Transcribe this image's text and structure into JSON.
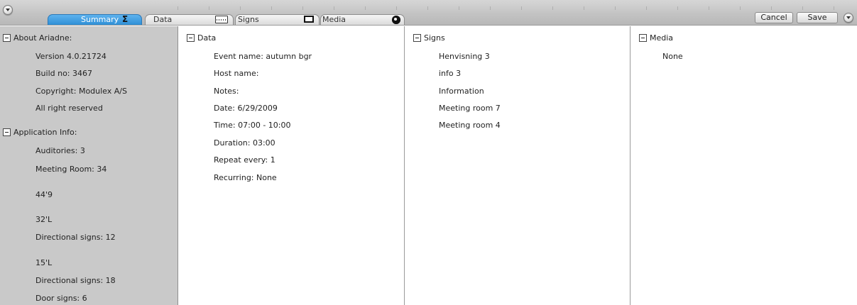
{
  "toolbar": {
    "tabs": [
      {
        "label": "Summary",
        "icon": "sigma-icon",
        "glyph": "Σ",
        "active": true
      },
      {
        "label": "Data",
        "icon": "keyboard-icon",
        "active": false
      },
      {
        "label": "Signs",
        "icon": "rectangle-icon",
        "active": false
      },
      {
        "label": "Media",
        "icon": "disc-icon",
        "active": false
      }
    ],
    "cancel_label": "Cancel",
    "save_label": "Save",
    "accent_color": "#3a9be0"
  },
  "summary": {
    "about": {
      "title": "About Ariadne:",
      "items": [
        "Version 4.0.21724",
        "Build no: 3467",
        "Copyright: Modulex A/S",
        "All right reserved"
      ]
    },
    "application": {
      "title": "Application Info:",
      "items": [
        "Auditories: 3",
        "Meeting Room: 34",
        "44'9",
        "32'L",
        "Directional signs: 12",
        "15'L",
        "Directional signs: 18",
        "Door signs: 6"
      ]
    }
  },
  "data_panel": {
    "title": "Data",
    "items": [
      "Event name: autumn bgr",
      "Host name:",
      "Notes:",
      "Date: 6/29/2009",
      "Time: 07:00 - 10:00",
      "Duration: 03:00",
      "Repeat every: 1",
      "Recurring: None"
    ]
  },
  "signs_panel": {
    "title": "Signs",
    "items": [
      "Henvisning 3",
      "info 3",
      "Information",
      "Meeting room 7",
      "Meeting room 4"
    ]
  },
  "media_panel": {
    "title": "Media",
    "items": [
      "None"
    ]
  }
}
